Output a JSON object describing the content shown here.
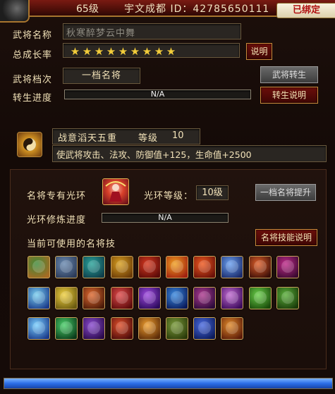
{
  "header": {
    "level": "65级",
    "info": "宇文成都 ID：42785650111",
    "bound_tag": "已绑定"
  },
  "general": {
    "name_label": "武将名称",
    "name_value": "秋寒醉梦云中舞",
    "growth_label": "总成长率",
    "stars": [
      "★",
      "★",
      "★",
      "★",
      "★",
      "★",
      "★",
      "★",
      "★"
    ],
    "growth_button": "说明",
    "tier_label": "武将档次",
    "tier_value": "一档名将",
    "rebirth_button": "武将转生",
    "rebirth_progress_label": "转生进度",
    "rebirth_progress_text": "N/A",
    "rebirth_help_button": "转生说明"
  },
  "fate": {
    "title": "战意滔天五重",
    "level_label": "等级",
    "level_value": "10",
    "description": "使武将攻击、法攻、防御值+125，生命值+2500"
  },
  "halo": {
    "label": "名将专有光环",
    "level_label": "光环等级：",
    "level_value": "10级",
    "upgrade_button": "一档名将提升",
    "train_label": "光环修炼进度",
    "train_progress_text": "N/A",
    "skills_label": "当前可使用的名将技",
    "skills_help_button": "名将技能说明"
  },
  "skills": [
    {
      "icon": "axe-strike-icon",
      "c1": "#3d8a3a",
      "c2": "#a86a22"
    },
    {
      "icon": "hammer-icon",
      "c1": "#6a8ab0",
      "c2": "#2b3a58"
    },
    {
      "icon": "whirlwind-icon",
      "c1": "#2aa39a",
      "c2": "#0e3d4a"
    },
    {
      "icon": "golden-blade-icon",
      "c1": "#d9a020",
      "c2": "#6a3a08"
    },
    {
      "icon": "crimson-slash-icon",
      "c1": "#d83a20",
      "c2": "#5a0a08"
    },
    {
      "icon": "flame-wing-icon",
      "c1": "#f0a020",
      "c2": "#a02010"
    },
    {
      "icon": "fire-blade-icon",
      "c1": "#f05a20",
      "c2": "#6a1008"
    },
    {
      "icon": "ice-dash-icon",
      "c1": "#6aa0f0",
      "c2": "#1a2a6a"
    },
    {
      "icon": "berserker-icon",
      "c1": "#e0602a",
      "c2": "#3a0e08"
    },
    {
      "icon": "demon-wings-icon",
      "c1": "#c02a8a",
      "c2": "#3a0a30"
    },
    {
      "icon": "frost-bird-icon",
      "c1": "#7ad0f0",
      "c2": "#1a3a8a"
    },
    {
      "icon": "holy-light-icon",
      "c1": "#f0d040",
      "c2": "#6a5a10"
    },
    {
      "icon": "dragon-blast-icon",
      "c1": "#e06a30",
      "c2": "#4a1a08"
    },
    {
      "icon": "heart-card-icon",
      "c1": "#e04a4a",
      "c2": "#5a0a0a"
    },
    {
      "icon": "spiral-icon",
      "c1": "#a04ae0",
      "c2": "#2a0a5a"
    },
    {
      "icon": "wave-orb-icon",
      "c1": "#3a8ae0",
      "c2": "#0a1a5a"
    },
    {
      "icon": "dark-summon-icon",
      "c1": "#b03a90",
      "c2": "#2a0a3a"
    },
    {
      "icon": "purple-vortex-icon",
      "c1": "#c06ad0",
      "c2": "#3a0a5a"
    },
    {
      "icon": "green-beast-icon",
      "c1": "#6ad04a",
      "c2": "#1a4a0a"
    },
    {
      "icon": "nature-warrior-icon",
      "c1": "#5ab03a",
      "c2": "#1a3a0a"
    },
    {
      "icon": "lightning-body-icon",
      "c1": "#7ad0ff",
      "c2": "#1a3a8a"
    },
    {
      "icon": "green-ray-icon",
      "c1": "#4ad06a",
      "c2": "#0a3a1a"
    },
    {
      "icon": "guardian-icon",
      "c1": "#8a4ad0",
      "c2": "#2a0a4a"
    },
    {
      "icon": "flame-pillar-icon",
      "c1": "#e0502a",
      "c2": "#4a0a0a"
    },
    {
      "icon": "fire-burst-icon",
      "c1": "#f0a030",
      "c2": "#5a2a08"
    },
    {
      "icon": "earth-warrior-icon",
      "c1": "#7a9a3a",
      "c2": "#2a3a0a"
    },
    {
      "icon": "blue-storm-icon",
      "c1": "#4a6ae0",
      "c2": "#0a1a5a"
    },
    {
      "icon": "rage-icon",
      "c1": "#e08a2a",
      "c2": "#5a1a08"
    }
  ]
}
